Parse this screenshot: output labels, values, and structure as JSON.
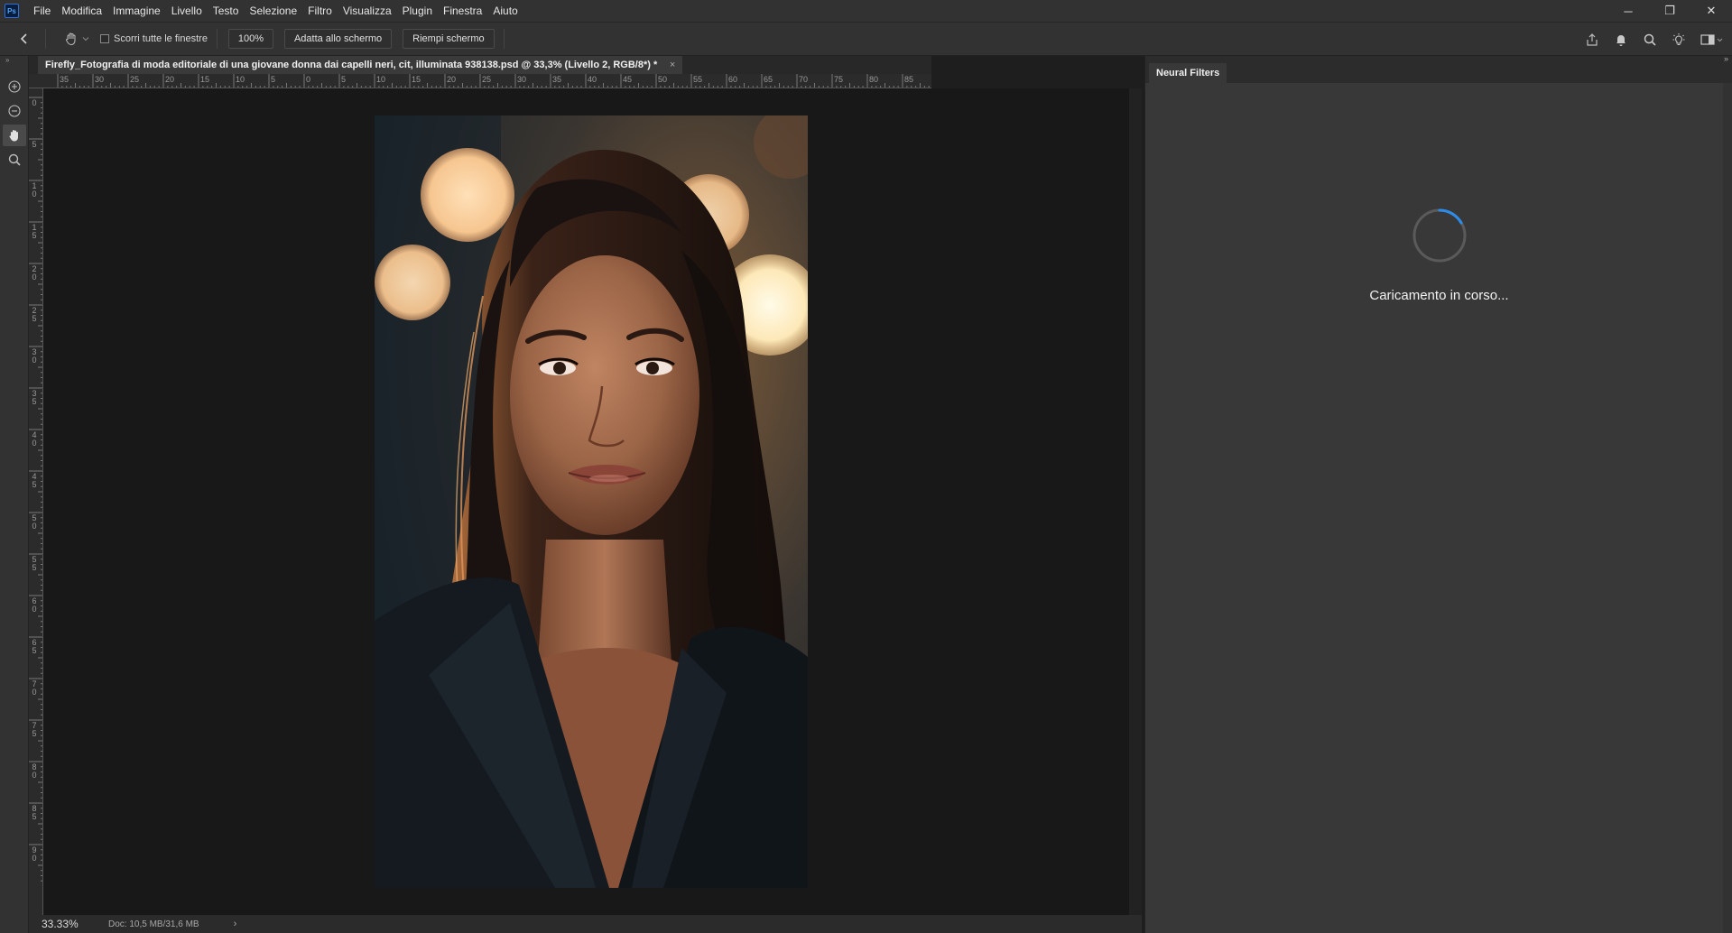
{
  "app": {
    "logo": "Ps"
  },
  "menu": [
    "File",
    "Modifica",
    "Immagine",
    "Livello",
    "Testo",
    "Selezione",
    "Filtro",
    "Visualizza",
    "Plugin",
    "Finestra",
    "Aiuto"
  ],
  "window_controls": {
    "minimize": "─",
    "restore": "❐",
    "close": "✕"
  },
  "options_bar": {
    "scroll_all_label": "Scorri tutte le finestre",
    "zoom_value": "100%",
    "fit_screen_label": "Adatta allo schermo",
    "fill_screen_label": "Riempi schermo"
  },
  "document": {
    "tab_title": "Firefly_Fotografia di moda editoriale di una giovane donna dai capelli neri, cit, illuminata  938138.psd @ 33,3% (Livello 2, RGB/8*) *",
    "tab_close": "×"
  },
  "rulers": {
    "horizontal": [
      "35",
      "30",
      "25",
      "20",
      "15",
      "10",
      "5",
      "0",
      "5",
      "10",
      "15",
      "20",
      "25",
      "30",
      "35",
      "40",
      "45",
      "50",
      "55",
      "60",
      "65",
      "70",
      "75",
      "80",
      "85"
    ],
    "vertical": [
      "0",
      "5",
      "1 0",
      "1 5",
      "2 0",
      "2 5",
      "3 0",
      "3 5",
      "4 0",
      "4 5",
      "5 0",
      "5 5",
      "6 0",
      "6 5",
      "7 0",
      "7 5",
      "8 0",
      "8 5",
      "9 0"
    ]
  },
  "status": {
    "zoom": "33.33%",
    "doc_info": "Doc: 10,5 MB/31,6 MB",
    "arrow": "›"
  },
  "panel": {
    "tab_label": "Neural Filters",
    "loading_text": "Caricamento in corso..."
  },
  "colors": {
    "accent_spinner": "#2d8ceb",
    "ps_blue": "#31a8ff"
  },
  "icons": [
    "back-arrow-icon",
    "hand-icon",
    "zoom-in-icon",
    "zoom-out-icon",
    "search-icon",
    "share-icon",
    "bell-icon",
    "lightbulb-icon",
    "workspace-icon",
    "spinner-icon"
  ]
}
